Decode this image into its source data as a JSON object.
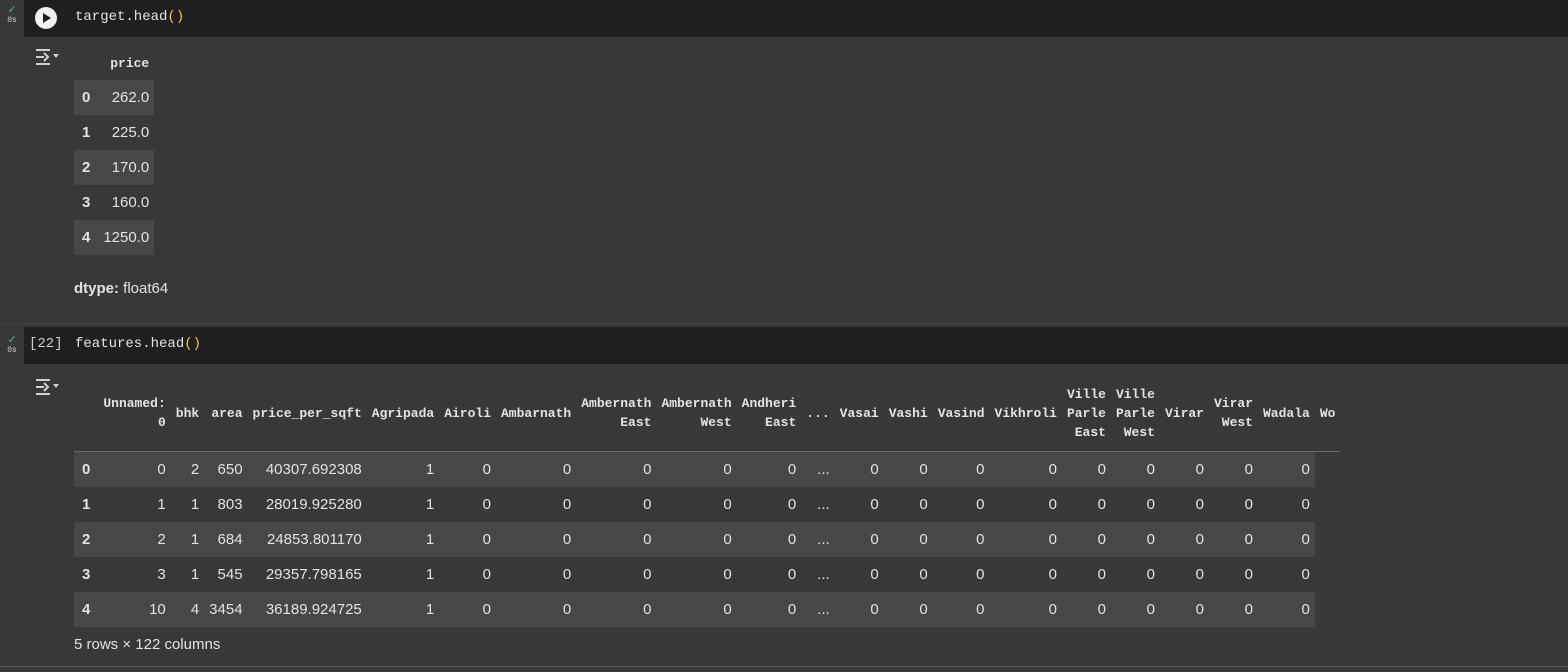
{
  "cell1": {
    "status_label": "0s",
    "code_name": "target.head",
    "code_parens": "()",
    "table": {
      "header": "price",
      "rows": [
        {
          "index": "0",
          "price": "262.0"
        },
        {
          "index": "1",
          "price": "225.0"
        },
        {
          "index": "2",
          "price": "170.0"
        },
        {
          "index": "3",
          "price": "160.0"
        },
        {
          "index": "4",
          "price": "1250.0"
        }
      ]
    },
    "dtype_label": "dtype:",
    "dtype_value": "float64"
  },
  "cell2": {
    "status_label": "0s",
    "exec_count": "[22]",
    "code_name": "features.head",
    "code_parens": "()",
    "columns": [
      "Unnamed: 0",
      "bhk",
      "area",
      "price_per_sqft",
      "Agripada",
      "Airoli",
      "Ambarnath",
      "Ambernath East",
      "Ambernath West",
      "Andheri East",
      "...",
      "Vasai",
      "Vashi",
      "Vasind",
      "Vikhroli",
      "Ville Parle East",
      "Ville Parle West",
      "Virar",
      "Virar West",
      "Wadala",
      "Wo"
    ],
    "rows": [
      [
        "0",
        "0",
        "2",
        "650",
        "40307.692308",
        "1",
        "0",
        "0",
        "0",
        "0",
        "0",
        "...",
        "0",
        "0",
        "0",
        "0",
        "0",
        "0",
        "0",
        "0",
        "0"
      ],
      [
        "1",
        "1",
        "1",
        "803",
        "28019.925280",
        "1",
        "0",
        "0",
        "0",
        "0",
        "0",
        "...",
        "0",
        "0",
        "0",
        "0",
        "0",
        "0",
        "0",
        "0",
        "0"
      ],
      [
        "2",
        "2",
        "1",
        "684",
        "24853.801170",
        "1",
        "0",
        "0",
        "0",
        "0",
        "0",
        "...",
        "0",
        "0",
        "0",
        "0",
        "0",
        "0",
        "0",
        "0",
        "0"
      ],
      [
        "3",
        "3",
        "1",
        "545",
        "29357.798165",
        "1",
        "0",
        "0",
        "0",
        "0",
        "0",
        "...",
        "0",
        "0",
        "0",
        "0",
        "0",
        "0",
        "0",
        "0",
        "0"
      ],
      [
        "4",
        "10",
        "4",
        "3454",
        "36189.924725",
        "1",
        "0",
        "0",
        "0",
        "0",
        "0",
        "...",
        "0",
        "0",
        "0",
        "0",
        "0",
        "0",
        "0",
        "0",
        "0"
      ]
    ],
    "shape_note": "5 rows × 122 columns"
  },
  "icons": {
    "run": "play-icon",
    "output_toggle": "output-actions-icon",
    "success": "check-icon"
  },
  "colors": {
    "accent_paren": "#f7c344",
    "success": "#5bb974"
  }
}
